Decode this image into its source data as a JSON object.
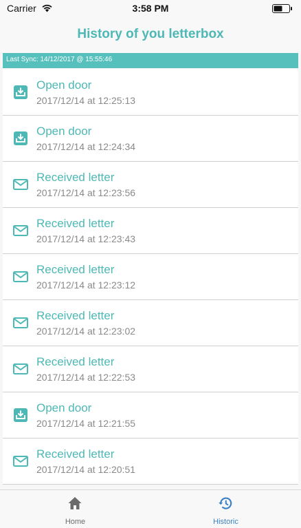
{
  "status_bar": {
    "carrier": "Carrier",
    "time": "3:58 PM"
  },
  "header": {
    "title": "History of you letterbox"
  },
  "sync": {
    "text": "Last Sync: 14/12/2017 @ 15:55:46"
  },
  "history": [
    {
      "title": "Open door",
      "time": "2017/12/14 at 12:25:13",
      "icon": "open-door-icon"
    },
    {
      "title": "Open door",
      "time": "2017/12/14 at 12:24:34",
      "icon": "open-door-icon"
    },
    {
      "title": "Received letter",
      "time": "2017/12/14 at 12:23:56",
      "icon": "mail-icon"
    },
    {
      "title": "Received letter",
      "time": "2017/12/14 at 12:23:43",
      "icon": "mail-icon"
    },
    {
      "title": "Received letter",
      "time": "2017/12/14 at 12:23:12",
      "icon": "mail-icon"
    },
    {
      "title": "Received letter",
      "time": "2017/12/14 at 12:23:02",
      "icon": "mail-icon"
    },
    {
      "title": "Received letter",
      "time": "2017/12/14 at 12:22:53",
      "icon": "mail-icon"
    },
    {
      "title": "Open door",
      "time": "2017/12/14 at 12:21:55",
      "icon": "open-door-icon"
    },
    {
      "title": "Received letter",
      "time": "2017/12/14 at 12:20:51",
      "icon": "mail-icon"
    }
  ],
  "tabs": [
    {
      "label": "Home",
      "icon": "home-icon",
      "active": false
    },
    {
      "label": "Historic",
      "icon": "history-icon",
      "active": true
    }
  ],
  "colors": {
    "accent": "#4db8b5",
    "sync_bar": "#56c0bd",
    "active_tab": "#3b82c4",
    "inactive_tab": "#6b6b6b"
  }
}
